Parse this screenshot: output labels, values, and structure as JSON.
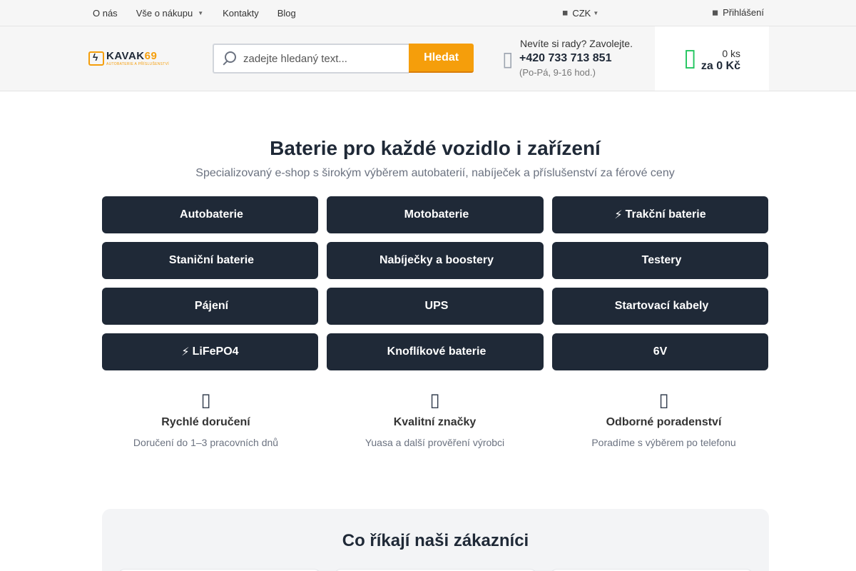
{
  "topbar": {
    "nav": [
      {
        "label": "O nás"
      },
      {
        "label": "Vše o nákupu"
      },
      {
        "label": "Kontakty"
      },
      {
        "label": "Blog"
      }
    ],
    "currency": "CZK",
    "login": "Přihlášení",
    "icons": {
      "currency": "currency-icon",
      "login": "user-icon",
      "caret": "chevron-down-icon"
    }
  },
  "header": {
    "logo": {
      "main": "KAVAK",
      "number": "69",
      "sub": "AUTOBATERIE A PŘÍSLUŠENSTVÍ"
    },
    "search": {
      "placeholder": "zadejte hledaný text...",
      "value": "",
      "button": "Hledat"
    },
    "help": {
      "question": "Nevíte si rady? Zavolejte.",
      "phone": "+420 733 713 851",
      "hours": "(Po-Pá, 9-16 hod.)"
    },
    "cart": {
      "count": "0 ks",
      "price": "za 0 Kč"
    }
  },
  "hero": {
    "title": "Baterie pro každé vozidlo i zařízení",
    "subtitle": "Specializovaný e-shop s širokým výběrem autobaterií, nabíječek a příslušenství za férové ceny"
  },
  "categories": [
    {
      "icon": "",
      "label": "Autobaterie"
    },
    {
      "icon": "",
      "label": "Motobaterie"
    },
    {
      "icon": "⚡",
      "label": "Trakční baterie"
    },
    {
      "icon": "",
      "label": "Staniční baterie"
    },
    {
      "icon": "",
      "label": "Nabíječky a boostery"
    },
    {
      "icon": "",
      "label": "Testery"
    },
    {
      "icon": "",
      "label": "Pájení"
    },
    {
      "icon": "",
      "label": "UPS"
    },
    {
      "icon": "",
      "label": "Startovací kabely"
    },
    {
      "icon": "⚡",
      "label": "LiFePO4"
    },
    {
      "icon": "",
      "label": "Knoflíkové baterie"
    },
    {
      "icon": "",
      "label": "6V"
    }
  ],
  "features": [
    {
      "title": "Rychlé doručení",
      "desc": "Doručení do 1–3 pracovních dnů"
    },
    {
      "title": "Kvalitní značky",
      "desc": "Yuasa a další prověření výrobci"
    },
    {
      "title": "Odborné poradenství",
      "desc": "Poradíme s výběrem po telefonu"
    }
  ],
  "reviews": {
    "title": "Co říkají naši zákazníci"
  },
  "colors": {
    "accent": "#f59e0b",
    "dark": "#1f2937",
    "cart": "#22c55e"
  }
}
